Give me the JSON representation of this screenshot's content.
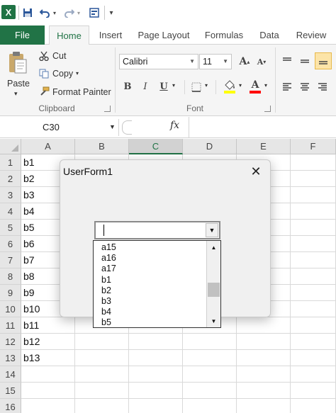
{
  "app": {
    "logo": "X",
    "accent_color": "#217346"
  },
  "qat": {
    "icons": [
      "save-icon",
      "undo-icon",
      "redo-icon",
      "form-icon",
      "customize-icon"
    ]
  },
  "tabs": [
    {
      "label": "File"
    },
    {
      "label": "Home"
    },
    {
      "label": "Insert"
    },
    {
      "label": "Page Layout"
    },
    {
      "label": "Formulas"
    },
    {
      "label": "Data"
    },
    {
      "label": "Review"
    }
  ],
  "ribbon": {
    "clipboard": {
      "paste_label": "Paste",
      "cut_label": "Cut",
      "copy_label": "Copy",
      "format_painter_label": "Format Painter",
      "group_label": "Clipboard"
    },
    "font": {
      "font_name": "Calibri",
      "font_size": "11",
      "bold": "B",
      "italic": "I",
      "underline": "U",
      "grow": "A",
      "shrink": "A",
      "font_color": "A",
      "group_label": "Font"
    }
  },
  "formula_bar": {
    "name_box": "C30",
    "fx": "fx"
  },
  "sheet": {
    "columns": [
      "A",
      "B",
      "C",
      "D",
      "E",
      "F"
    ],
    "selected_column": "C",
    "rows": [
      "1",
      "2",
      "3",
      "4",
      "5",
      "6",
      "7",
      "8",
      "9",
      "10",
      "11",
      "12",
      "13",
      "14",
      "15",
      "16"
    ],
    "col_a_values": [
      "b1",
      "b2",
      "b3",
      "b4",
      "b5",
      "b6",
      "b7",
      "b8",
      "b9",
      "b10",
      "b11",
      "b12",
      "b13"
    ]
  },
  "userform": {
    "title": "UserForm1",
    "combo_value": "",
    "list_items": [
      "a15",
      "a16",
      "a17",
      "b1",
      "b2",
      "b3",
      "b4",
      "b5"
    ]
  }
}
